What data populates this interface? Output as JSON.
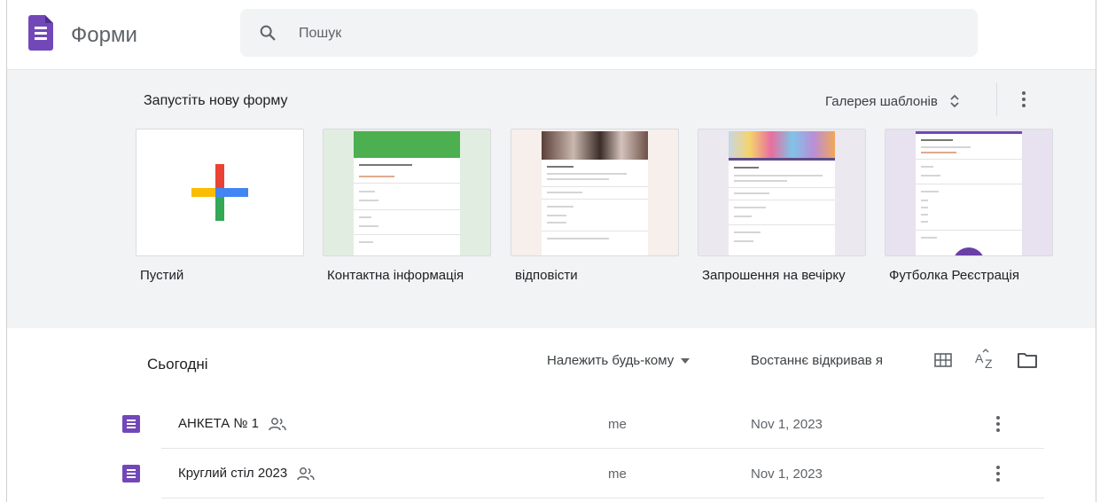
{
  "app": {
    "title": "Форми"
  },
  "search": {
    "placeholder": "Пошук"
  },
  "templates": {
    "heading": "Запустіть нову форму",
    "gallery_label": "Галерея шаблонів",
    "items": [
      {
        "label": "Пустий"
      },
      {
        "label": "Контактна інформація"
      },
      {
        "label": "відповісти"
      },
      {
        "label": "Запрошення на вечірку"
      },
      {
        "label": "Футболка Реєстрація"
      }
    ]
  },
  "list": {
    "section_title": "Сьогодні",
    "owner_filter": "Належить будь-кому",
    "sort_label": "Востаннє відкривав я",
    "rows": [
      {
        "name": "АНКЕТА № 1",
        "owner": "me",
        "date": "Nov 1, 2023",
        "shared": true
      },
      {
        "name": "Круглий стіл 2023",
        "owner": "me",
        "date": "Nov 1, 2023",
        "shared": true
      }
    ]
  },
  "colors": {
    "forms_purple": "#7248b9",
    "header_bg": "#ffffff",
    "templates_bg": "#f1f3f4"
  },
  "icons": [
    "forms-logo-icon",
    "search-icon",
    "unfold-icon",
    "more-vert-icon",
    "plus-icon",
    "grid-view-icon",
    "sort-az-icon",
    "folder-icon",
    "shared-people-icon",
    "dropdown-arrow-icon"
  ]
}
